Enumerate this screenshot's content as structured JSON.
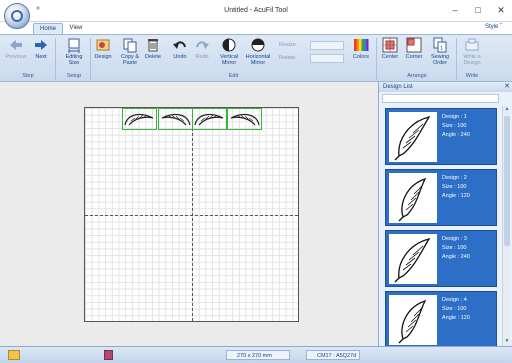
{
  "window": {
    "title": "Untitled - AcuFil Tool",
    "qat_glyph": "»",
    "controls": {
      "minimize": "–",
      "maximize": "□",
      "close": "✕"
    }
  },
  "tabs": [
    {
      "label": "Home",
      "active": true
    },
    {
      "label": "View",
      "active": false
    }
  ],
  "style_menu": "Style ˇ",
  "ribbon": {
    "buttons": {
      "previous": "Previous",
      "next": "Next",
      "editing_size": "Editing\nSize",
      "design": "Design",
      "copy_paste": "Copy &\nPaste",
      "delete": "Delete",
      "undo": "Undo",
      "redo": "Redo",
      "vertical_mirror": "Vertical\nMirror",
      "horizontal_mirror": "Horizontal\nMirror",
      "resize": "Resize",
      "rotate": "Rotate",
      "colors": "Colors",
      "center": "Center",
      "corner": "Corner",
      "sewing_order": "Sewing\nOrder",
      "write_design": "Write a\nDesign"
    },
    "groups": {
      "step": "Step",
      "setup": "Setup",
      "edit": "Edit",
      "arrange": "Arrange",
      "write": "Write"
    }
  },
  "design_list": {
    "title": "Design List",
    "close": "✕",
    "items": [
      {
        "design": "Design : 1",
        "size": "Size : 100",
        "angle": "Angle : 240"
      },
      {
        "design": "Design : 2",
        "size": "Size : 100",
        "angle": "Angle : 120"
      },
      {
        "design": "Design : 3",
        "size": "Size : 100",
        "angle": "Angle : 240"
      },
      {
        "design": "Design : 4",
        "size": "Size : 100",
        "angle": "Angle : 120"
      }
    ]
  },
  "status": {
    "canvas_size": "270 x 270 mm",
    "device": "CM17 : A5Q27d"
  },
  "colors": {
    "ribbon_text": "#15428b",
    "card_bg": "#2d6fc7",
    "tile_border": "#3cb043"
  }
}
